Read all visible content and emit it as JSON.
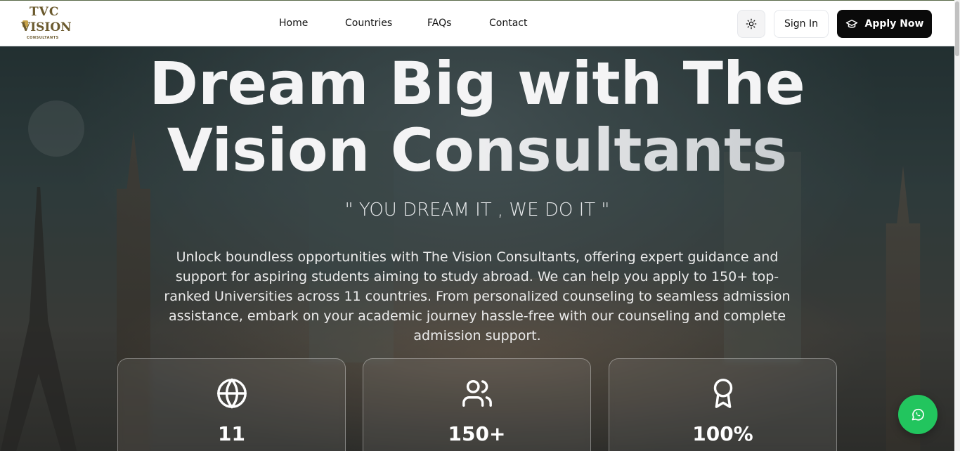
{
  "brand": {
    "logo_text_top": "TVC",
    "logo_text_main": "VISION",
    "logo_text_sub": "CONSULTANTS"
  },
  "nav": {
    "items": [
      {
        "label": "Home"
      },
      {
        "label": "Countries"
      },
      {
        "label": "FAQs"
      },
      {
        "label": "Contact"
      }
    ],
    "theme_toggle_icon": "sun-icon",
    "signin_label": "Sign In",
    "apply_label": "Apply Now",
    "apply_icon": "graduation-cap-icon"
  },
  "hero": {
    "title_line1": "Dream Big with The",
    "title_line2": "Vision Consultants",
    "tagline": "\" YOU DREAM IT , WE DO IT \"",
    "description": "Unlock boundless opportunities with The Vision Consultants, offering expert guidance and support for aspiring students aiming to study abroad. We can help you apply to 150+ top-ranked Universities across 11 countries. From personalized counseling to seamless admission assistance, embark on your academic journey hassle-free with our counseling and complete admission support."
  },
  "stats": [
    {
      "icon": "globe-icon",
      "value": "11"
    },
    {
      "icon": "users-icon",
      "value": "150+"
    },
    {
      "icon": "award-icon",
      "value": "100%"
    }
  ],
  "floating": {
    "whatsapp_icon": "whatsapp-icon",
    "whatsapp_color": "#22c55e"
  },
  "colors": {
    "primary_button": "#0a0a0a",
    "logo_gold": "#6b5a2e"
  }
}
